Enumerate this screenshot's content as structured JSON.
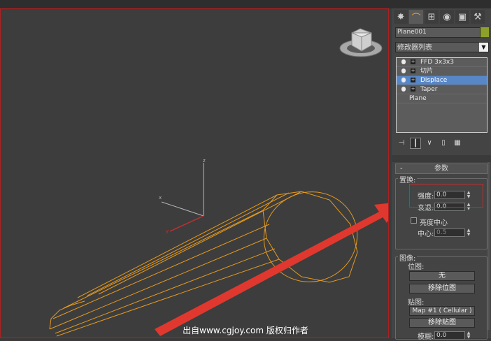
{
  "viewport": {
    "watermark": "出自www.cgjoy.com 版权归作者",
    "axis_labels": {
      "z": "z",
      "x": "x",
      "y": "y"
    }
  },
  "command_panel": {
    "tabs": [
      {
        "icon": "create-icon",
        "glyph": "✸"
      },
      {
        "icon": "modify-icon",
        "glyph": "⌒"
      },
      {
        "icon": "hierarchy-icon",
        "glyph": "⊞"
      },
      {
        "icon": "motion-icon",
        "glyph": "◉"
      },
      {
        "icon": "display-icon",
        "glyph": "▣"
      },
      {
        "icon": "utilities-icon",
        "glyph": "⚒"
      }
    ],
    "object_name": "Plane001",
    "object_color": "#8da12a",
    "modifier_list": "修改器列表",
    "stack": [
      {
        "label": "FFD 3x3x3",
        "selected": false
      },
      {
        "label": "切片",
        "selected": false
      },
      {
        "label": "Displace",
        "selected": true
      },
      {
        "label": "Taper",
        "selected": false
      },
      {
        "label": "Plane",
        "selected": false,
        "base": true
      }
    ],
    "stack_buttons": [
      "pin-stack-icon",
      "show-end-result-icon",
      "make-unique-icon",
      "remove-modifier-icon",
      "configure-sets-icon"
    ],
    "rollout": {
      "minus": "-",
      "title": "参数",
      "displace_group": "置换:",
      "strength_label": "强度:",
      "strength_value": "0.0",
      "decay_label": "衰退:",
      "decay_value": "0.0",
      "luminance_center_label": "亮度中心",
      "center_label": "中心:",
      "center_value": "0.5",
      "image_group": "图像:",
      "bitmap_label": "位图:",
      "bitmap_button": "无",
      "remove_bitmap": "移除位图",
      "map_label": "贴图:",
      "map_button": "Map #1  ( Cellular )",
      "remove_map": "移除贴图",
      "blur_label": "模糊:",
      "blur_value": "0.0"
    }
  }
}
